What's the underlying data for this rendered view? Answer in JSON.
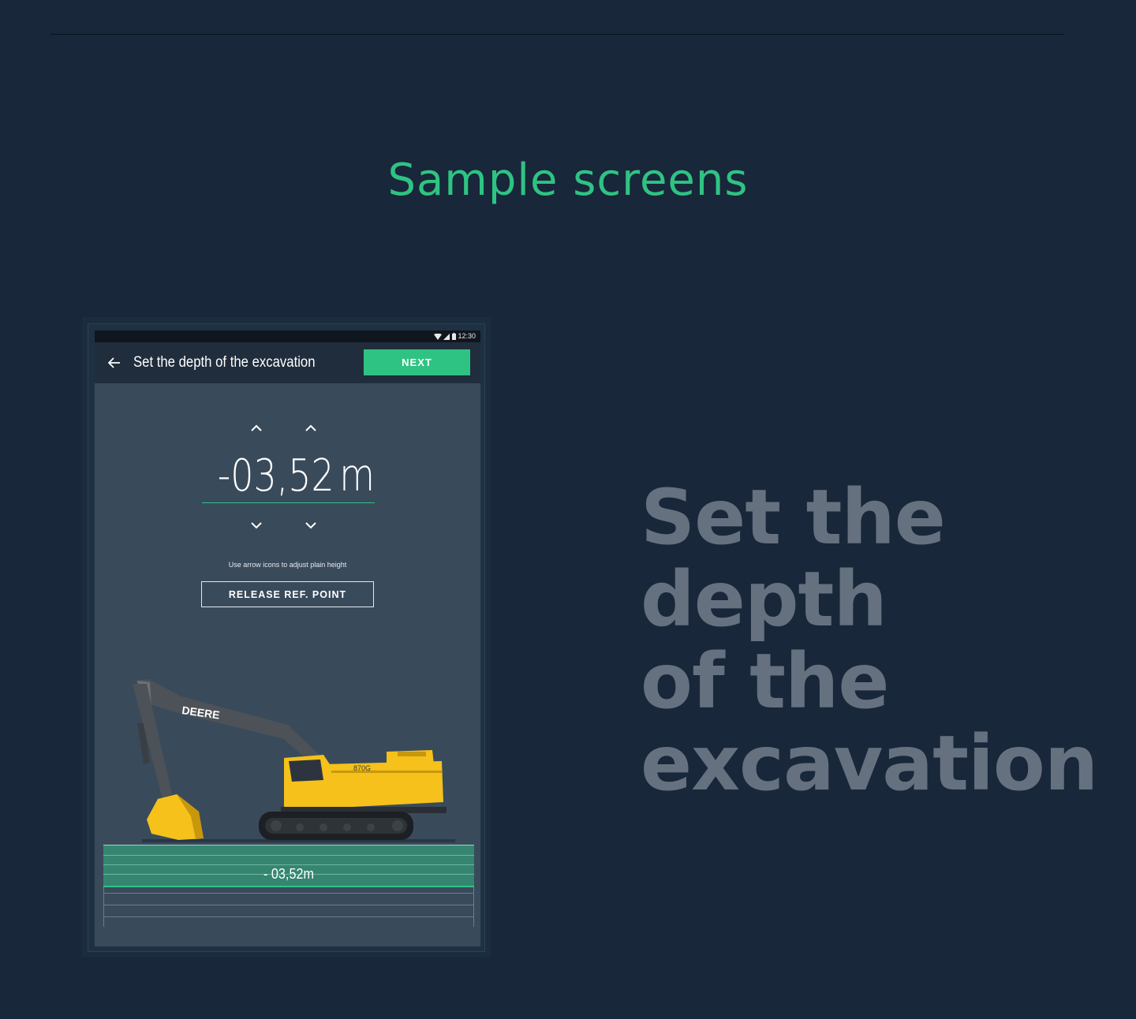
{
  "page": {
    "section_title": "Sample screens",
    "heading_lines": [
      "Set the",
      "depth",
      "of the",
      "excavation"
    ]
  },
  "colors": {
    "background": "#18273a",
    "accent": "#2fc383",
    "heading": "#667180",
    "screen_bg": "#394a5b",
    "app_bar": "#202d3c",
    "excavator_yellow": "#f5c11a"
  },
  "phone": {
    "status_bar": {
      "time": "12:30",
      "icons": [
        "wifi-icon",
        "signal-icon",
        "battery-icon"
      ]
    },
    "app_bar": {
      "back_icon": "arrow-left-icon",
      "title": "Set the depth of the excavation",
      "next_label": "NEXT"
    },
    "depth_control": {
      "value": "-03,52",
      "unit": "m",
      "up_icons": [
        "chevron-up-icon",
        "chevron-up-icon"
      ],
      "down_icons": [
        "chevron-down-icon",
        "chevron-down-icon"
      ]
    },
    "hint": "Use arrow icons to adjust plain height",
    "release_label": "RELEASE REF. POINT",
    "excavator": {
      "brand": "DEERE",
      "model": "870G"
    },
    "ground_depth_label": "- 03,52m"
  }
}
